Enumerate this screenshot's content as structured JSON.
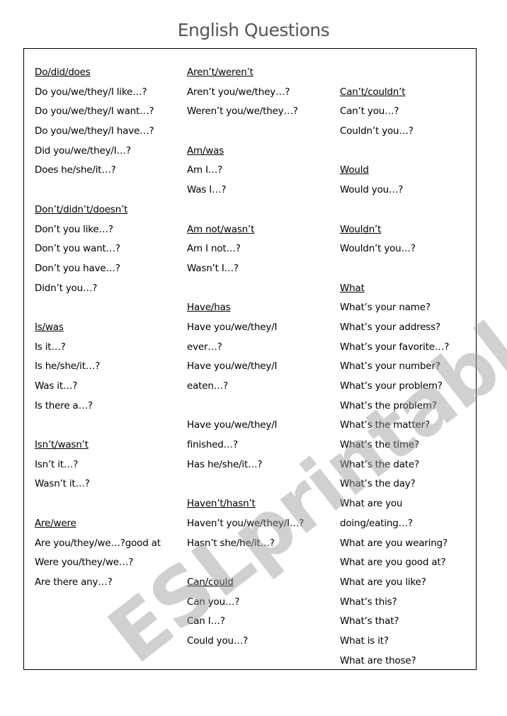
{
  "title": "English Questions",
  "watermark": "ESLprintables.com",
  "columns": [
    {
      "lines": [
        {
          "text": "Do/did/does",
          "type": "head"
        },
        {
          "text": "Do you/we/they/I like…?",
          "type": "item"
        },
        {
          "text": "Do you/we/they/I want…?",
          "type": "item"
        },
        {
          "text": "Do you/we/they/I have…?",
          "type": "item"
        },
        {
          "text": "Did you/we/they/I…?",
          "type": "item"
        },
        {
          "text": "Does he/she/it…?",
          "type": "item"
        },
        {
          "text": "",
          "type": "blank"
        },
        {
          "text": "Don’t/didn’t/doesn’t",
          "type": "head"
        },
        {
          "text": "Don’t you like…?",
          "type": "item"
        },
        {
          "text": "Don’t you want…?",
          "type": "item"
        },
        {
          "text": "Don’t you have…?",
          "type": "item"
        },
        {
          "text": "Didn’t you…?",
          "type": "item"
        },
        {
          "text": "",
          "type": "blank"
        },
        {
          "text": "Is/was",
          "type": "head"
        },
        {
          "text": "Is it…?",
          "type": "item"
        },
        {
          "text": "Is he/she/it…?",
          "type": "item"
        },
        {
          "text": "Was it…?",
          "type": "item"
        },
        {
          "text": "Is there a…?",
          "type": "item"
        },
        {
          "text": "",
          "type": "blank"
        },
        {
          "text": "Isn’t/wasn’t",
          "type": "head"
        },
        {
          "text": "Isn’t it…?",
          "type": "item"
        },
        {
          "text": "Wasn’t it…?",
          "type": "item"
        },
        {
          "text": "",
          "type": "blank"
        },
        {
          "text": "Are/were",
          "type": "head"
        },
        {
          "text": "Are you/they/we…?good at",
          "type": "item"
        },
        {
          "text": "Were you/they/we…?",
          "type": "item"
        },
        {
          "text": "Are there any…?",
          "type": "item"
        }
      ]
    },
    {
      "lines": [
        {
          "text": "Aren’t/weren’t",
          "type": "head"
        },
        {
          "text": "Aren’t you/we/they…?",
          "type": "item"
        },
        {
          "text": "Weren’t you/we/they…?",
          "type": "item"
        },
        {
          "text": "",
          "type": "blank"
        },
        {
          "text": "Am/was",
          "type": "head"
        },
        {
          "text": "Am I…?",
          "type": "item"
        },
        {
          "text": "Was I…?",
          "type": "item"
        },
        {
          "text": "",
          "type": "blank"
        },
        {
          "text": "Am not/wasn’t",
          "type": "head"
        },
        {
          "text": "Am I not…?",
          "type": "item"
        },
        {
          "text": "Wasn’t I…?",
          "type": "item"
        },
        {
          "text": "",
          "type": "blank"
        },
        {
          "text": "Have/has",
          "type": "head"
        },
        {
          "text": "Have you/we/they/I",
          "type": "item"
        },
        {
          "text": "ever…?",
          "type": "item"
        },
        {
          "text": "Have you/we/they/I",
          "type": "item"
        },
        {
          "text": "eaten…?",
          "type": "item"
        },
        {
          "text": "",
          "type": "blank"
        },
        {
          "text": "Have you/we/they/I",
          "type": "item"
        },
        {
          "text": "finished…?",
          "type": "item"
        },
        {
          "text": "Has he/she/it…?",
          "type": "item"
        },
        {
          "text": "",
          "type": "blank"
        },
        {
          "text": "Haven’t/hasn’t",
          "type": "head"
        },
        {
          "text": "Haven’t you/we/they/I…?",
          "type": "item"
        },
        {
          "text": "Hasn’t she/he/it…?",
          "type": "item"
        },
        {
          "text": "",
          "type": "blank"
        },
        {
          "text": "Can/could",
          "type": "head"
        },
        {
          "text": "Can you…?",
          "type": "item"
        },
        {
          "text": "Can I…?",
          "type": "item"
        },
        {
          "text": "Could you…?",
          "type": "item"
        }
      ]
    },
    {
      "lines": [
        {
          "text": "",
          "type": "blank"
        },
        {
          "text": "Can’t/couldn’t",
          "type": "head"
        },
        {
          "text": "Can’t you…?",
          "type": "item"
        },
        {
          "text": "Couldn’t you…?",
          "type": "item"
        },
        {
          "text": "",
          "type": "blank"
        },
        {
          "text": "Would",
          "type": "head"
        },
        {
          "text": "Would you…?",
          "type": "item"
        },
        {
          "text": "",
          "type": "blank"
        },
        {
          "text": "Wouldn’t",
          "type": "head"
        },
        {
          "text": "Wouldn’t you…?",
          "type": "item"
        },
        {
          "text": "",
          "type": "blank"
        },
        {
          "text": "What",
          "type": "head"
        },
        {
          "text": "What’s your name?",
          "type": "item"
        },
        {
          "text": "What’s your address?",
          "type": "item"
        },
        {
          "text": "What’s your favorite…?",
          "type": "item"
        },
        {
          "text": "What’s your number?",
          "type": "item"
        },
        {
          "text": "What’s your problem?",
          "type": "item"
        },
        {
          "text": "What’s the problem?",
          "type": "item"
        },
        {
          "text": "What’s the matter?",
          "type": "item"
        },
        {
          "text": "What’s the time?",
          "type": "item"
        },
        {
          "text": "What’s the date?",
          "type": "item"
        },
        {
          "text": "What’s the day?",
          "type": "item"
        },
        {
          "text": "What are you",
          "type": "item"
        },
        {
          "text": "doing/eating…?",
          "type": "item"
        },
        {
          "text": "What are you wearing?",
          "type": "item"
        },
        {
          "text": "What are you good at?",
          "type": "item"
        },
        {
          "text": "What are you like?",
          "type": "item"
        },
        {
          "text": "What’s this?",
          "type": "item"
        },
        {
          "text": "What’s that?",
          "type": "item"
        },
        {
          "text": "What is it?",
          "type": "item"
        },
        {
          "text": "What are those?",
          "type": "item"
        }
      ]
    }
  ]
}
